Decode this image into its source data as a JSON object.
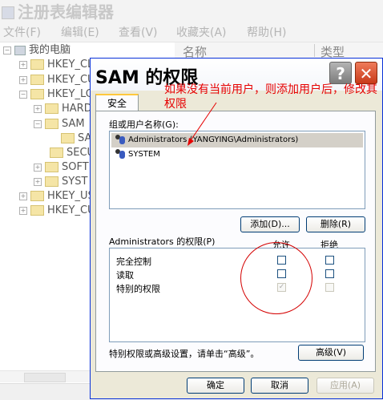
{
  "background_window": {
    "title": "注册表编辑器",
    "menu": [
      "文件(F)",
      "编辑(E)",
      "查看(V)",
      "收藏夹(A)",
      "帮助(H)"
    ],
    "list_headers": [
      "名称",
      "类型"
    ],
    "tree": [
      {
        "label": "我的电脑"
      },
      {
        "label": "HKEY_CL"
      },
      {
        "label": "HKEY_CU"
      },
      {
        "label": "HKEY_LO"
      },
      {
        "label": "HARD"
      },
      {
        "label": "SAM"
      },
      {
        "label": "SA"
      },
      {
        "label": "SECU"
      },
      {
        "label": "SOFT"
      },
      {
        "label": "SYST"
      },
      {
        "label": "HKEY_US"
      },
      {
        "label": "HKEY_CU"
      }
    ]
  },
  "dialog": {
    "title": "SAM 的权限",
    "annotation": "如果没有当前用户，则添加用户后，修改其权限",
    "tab": "安全",
    "users_label": "组或用户名称(G):",
    "users": [
      {
        "name": "Administrators (YANGYING\\Administrators)",
        "selected": true
      },
      {
        "name": "SYSTEM",
        "selected": false
      }
    ],
    "add_button": "添加(D)...",
    "remove_button": "删除(R)",
    "perm_label": "Administrators 的权限(P)",
    "allow_header": "允许",
    "deny_header": "拒绝",
    "permissions": [
      {
        "name": "完全控制",
        "allow": false,
        "deny": false,
        "disabled": false
      },
      {
        "name": "读取",
        "allow": false,
        "deny": false,
        "disabled": false
      },
      {
        "name": "特别的权限",
        "allow": true,
        "deny": false,
        "disabled": true
      }
    ],
    "advanced_text": "特别权限或高级设置，请单击“高级”。",
    "advanced_button": "高级(V)",
    "ok_button": "确定",
    "cancel_button": "取消",
    "apply_button": "应用(A)",
    "help_glyph": "?",
    "close_glyph": "✕",
    "annotation_color": "#e60000"
  }
}
